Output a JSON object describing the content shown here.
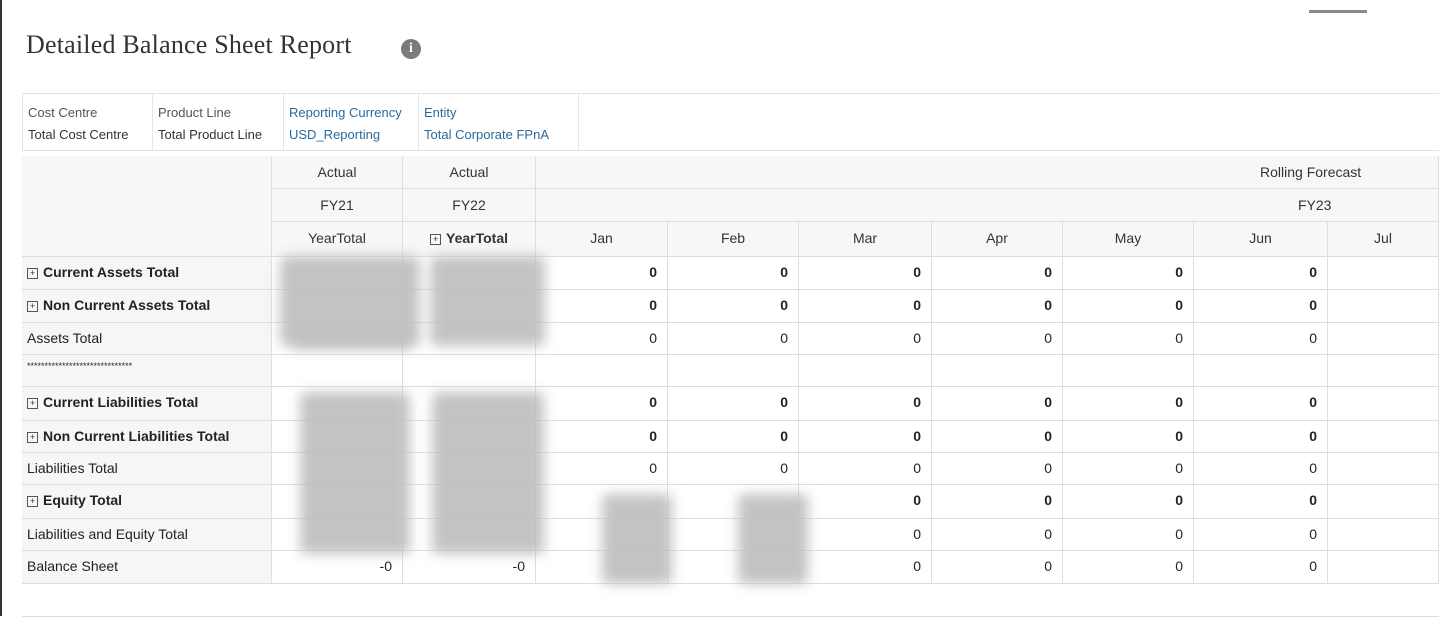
{
  "report": {
    "title": "Detailed Balance Sheet Report",
    "info_icon": "i"
  },
  "pov": [
    {
      "label": "Cost Centre",
      "value": "Total Cost Centre"
    },
    {
      "label": "Product Line",
      "value": "Total Product Line"
    },
    {
      "label": "Reporting Currency",
      "value": "USD_Reporting"
    },
    {
      "label": "Entity",
      "value": "Total Corporate FPnA"
    }
  ],
  "columns": {
    "scenario": [
      "Actual",
      "Actual",
      "Rolling Forecast"
    ],
    "year": [
      "FY21",
      "FY22",
      "FY23"
    ],
    "periods": [
      "YearTotal",
      "YearTotal",
      "Jan",
      "Feb",
      "Mar",
      "Apr",
      "May",
      "Jun",
      "Jul"
    ]
  },
  "rows": [
    {
      "label": "Current Assets Total",
      "expandable": true,
      "bold": true,
      "values": [
        "",
        "",
        "0",
        "0",
        "0",
        "0",
        "0",
        "0",
        ""
      ]
    },
    {
      "label": "Non Current Assets Total",
      "expandable": true,
      "bold": true,
      "values": [
        "",
        "",
        "0",
        "0",
        "0",
        "0",
        "0",
        "0",
        ""
      ]
    },
    {
      "label": "Assets Total",
      "expandable": false,
      "bold": false,
      "values": [
        "",
        "",
        "0",
        "0",
        "0",
        "0",
        "0",
        "0",
        ""
      ]
    },
    {
      "label": "******************************",
      "expandable": false,
      "bold": false,
      "values": [
        "",
        "",
        "",
        "",
        "",
        "",
        "",
        "",
        ""
      ]
    },
    {
      "label": "Current Liabilities Total",
      "expandable": true,
      "bold": true,
      "values": [
        "",
        "",
        "0",
        "0",
        "0",
        "0",
        "0",
        "0",
        ""
      ]
    },
    {
      "label": "Non Current Liabilities Total",
      "expandable": true,
      "bold": true,
      "values": [
        "",
        "",
        "0",
        "0",
        "0",
        "0",
        "0",
        "0",
        ""
      ]
    },
    {
      "label": "Liabilities Total",
      "expandable": false,
      "bold": false,
      "values": [
        "",
        "",
        "0",
        "0",
        "0",
        "0",
        "0",
        "0",
        ""
      ]
    },
    {
      "label": "Equity Total",
      "expandable": true,
      "bold": true,
      "values": [
        "",
        "",
        "",
        "",
        "0",
        "0",
        "0",
        "0",
        ""
      ]
    },
    {
      "label": "Liabilities and Equity Total",
      "expandable": false,
      "bold": false,
      "values": [
        "",
        "",
        "",
        "",
        "0",
        "0",
        "0",
        "0",
        ""
      ]
    },
    {
      "label": "Balance Sheet",
      "expandable": false,
      "bold": false,
      "values": [
        "-0",
        "-0",
        "",
        "",
        "0",
        "0",
        "0",
        "0",
        ""
      ]
    }
  ]
}
